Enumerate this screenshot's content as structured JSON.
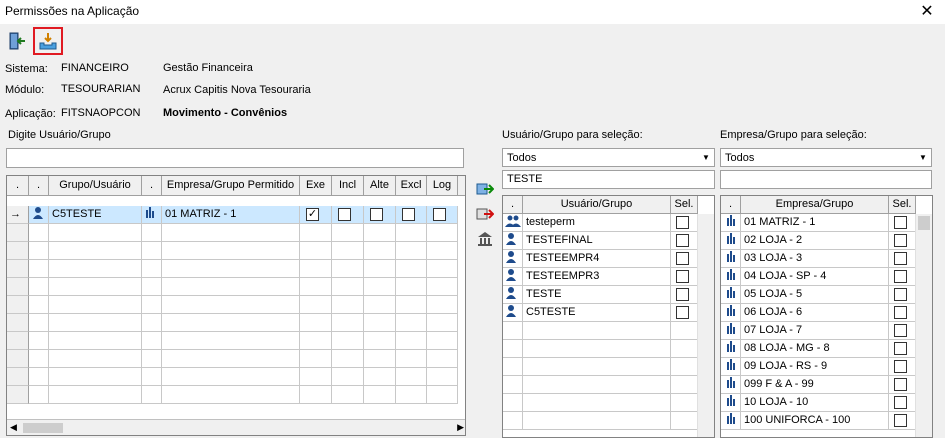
{
  "window": {
    "title": "Permissões na Aplicação",
    "close_glyph": "✕"
  },
  "toolbar": {
    "exit_icon": "exit-door-icon",
    "save_icon": "save-tray-icon"
  },
  "info": {
    "sistema_label": "Sistema:",
    "sistema_code": "FINANCEIRO",
    "sistema_name": "Gestão Financeira",
    "modulo_label": "Módulo:",
    "modulo_code": "TESOURARIAN",
    "modulo_name": "Acrux Capitis Nova Tesouraria",
    "aplicacao_label": "Aplicação:",
    "aplicacao_code": "FITSNAOPCON",
    "aplicacao_name": "Movimento - Convênios"
  },
  "left": {
    "search_label": "Digite Usuário/Grupo",
    "search_value": "",
    "headers": [
      ".",
      ".",
      "Grupo/Usuário",
      ".",
      "Empresa/Grupo Permitido",
      "Exe",
      "Incl",
      "Alte",
      "Excl",
      "Log"
    ],
    "rows": [
      {
        "indicator": "→",
        "user": "C5TESTE",
        "empresa": "01 MATRIZ - 1",
        "exe": true,
        "incl": false,
        "alte": false,
        "excl": false,
        "log": false
      }
    ]
  },
  "middle": {
    "label": "Usuário/Grupo para seleção:",
    "combo_value": "Todos",
    "filter_value": "TESTE",
    "headers": [
      ".",
      "Usuário/Grupo",
      "Sel."
    ],
    "rows": [
      {
        "name": "testeperm",
        "type": "group"
      },
      {
        "name": "TESTEFINAL",
        "type": "user"
      },
      {
        "name": "TESTEEMPR4",
        "type": "user"
      },
      {
        "name": "TESTEEMPR3",
        "type": "user"
      },
      {
        "name": "TESTE",
        "type": "user"
      },
      {
        "name": "C5TESTE",
        "type": "user"
      }
    ]
  },
  "right": {
    "label": "Empresa/Grupo para seleção:",
    "combo_value": "Todos",
    "filter_value": "",
    "headers": [
      ".",
      "Empresa/Grupo",
      "Sel."
    ],
    "rows": [
      "01 MATRIZ - 1",
      "02 LOJA - 2",
      "03 LOJA - 3",
      "04 LOJA - SP - 4",
      "05 LOJA - 5",
      "06 LOJA - 6",
      "07 LOJA - 7",
      "08 LOJA - MG - 8",
      "09 LOJA - RS - 9",
      "099 F & A - 99",
      "10 LOJA - 10",
      "100 UNIFORCA - 100"
    ]
  },
  "colors": {
    "selection": "#cce8ff",
    "highlight_border": "#e01a22",
    "header_bg": "#f0f0f0"
  }
}
